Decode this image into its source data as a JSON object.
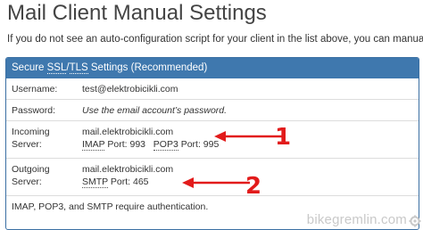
{
  "title": "Mail Client Manual Settings",
  "intro": "If you do not see an auto-configuration script for your client in the list above, you can manually configure your",
  "panel": {
    "header": {
      "prefix": "Secure ",
      "ssl": "SSL",
      "sep": "/",
      "tls": "TLS",
      "suffix": " Settings (Recommended)"
    },
    "username": {
      "label": "Username:",
      "value": "test@elektrobicikli.com"
    },
    "password": {
      "label": "Password:",
      "value": "Use the email account’s password."
    },
    "incoming": {
      "label": "Incoming Server:",
      "host": "mail.elektrobicikli.com",
      "imap_label": "IMAP",
      "imap_port": " Port: 993",
      "pop3_label": "POP3",
      "pop3_port": " Port: 995"
    },
    "outgoing": {
      "label": "Outgoing Server:",
      "host": "mail.elektrobicikli.com",
      "smtp_label": "SMTP",
      "smtp_port": " Port: 465"
    },
    "note": "IMAP, POP3, and SMTP require authentication."
  },
  "annotations": {
    "arrow_1": "1",
    "arrow_2": "2",
    "color": "#e21b1b"
  },
  "watermark": "bikegremlin.com",
  "colors": {
    "header_bg": "#3f78ae",
    "panel_border": "#3a6fa3"
  }
}
